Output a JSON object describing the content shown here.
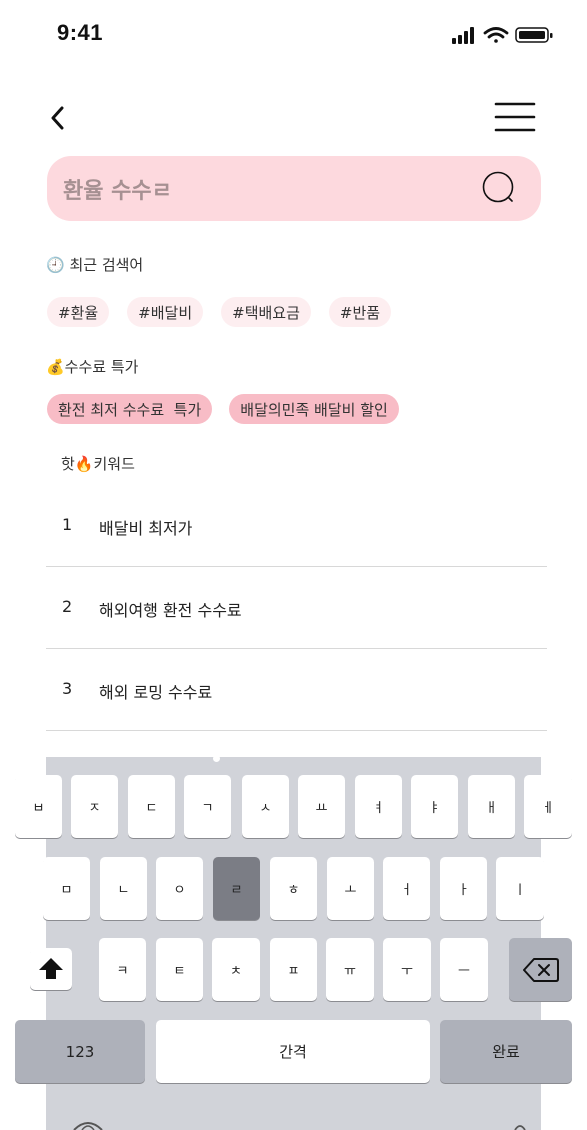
{
  "status": {
    "time": "9:41"
  },
  "search": {
    "value": "환율 수수ㄹ"
  },
  "recent": {
    "title": "🕘 최근 검색어",
    "tags": [
      "#환율",
      "#배달비",
      "#택배요금",
      "#반품"
    ]
  },
  "deals": {
    "title": "💰수수료 특가",
    "tags": [
      "환전 최저 수수료  특가",
      "배달의민족 배달비 할인"
    ]
  },
  "hot": {
    "title": "핫🔥키워드",
    "items": [
      {
        "rank": "1",
        "text": "배달비 최저가"
      },
      {
        "rank": "2",
        "text": "해외여행 환전 수수료"
      },
      {
        "rank": "3",
        "text": "해외 로밍 수수료"
      }
    ]
  },
  "keyboard": {
    "row1": [
      "ㅂ",
      "ㅈ",
      "ㄷ",
      "ㄱ",
      "ㅅ",
      "ㅛ",
      "ㅕ",
      "ㅑ",
      "ㅐ",
      "ㅔ"
    ],
    "row2": [
      "ㅁ",
      "ㄴ",
      "ㅇ",
      "ㄹ",
      "ㅎ",
      "ㅗ",
      "ㅓ",
      "ㅏ",
      "ㅣ"
    ],
    "row3": [
      "ㅋ",
      "ㅌ",
      "ㅊ",
      "ㅍ",
      "ㅠ",
      "ㅜ",
      "ㅡ"
    ],
    "numbers_label": "123",
    "space_label": "간격",
    "done_label": "완료",
    "pressed_key": "ㄹ"
  },
  "colors": {
    "search_bg": "#fdd9de",
    "recent_tag_bg": "#fdeef0",
    "deal_tag_bg": "#f8bcc6",
    "keyboard_bg": "#d1d3d9",
    "key_pressed": "#7b7d85"
  }
}
